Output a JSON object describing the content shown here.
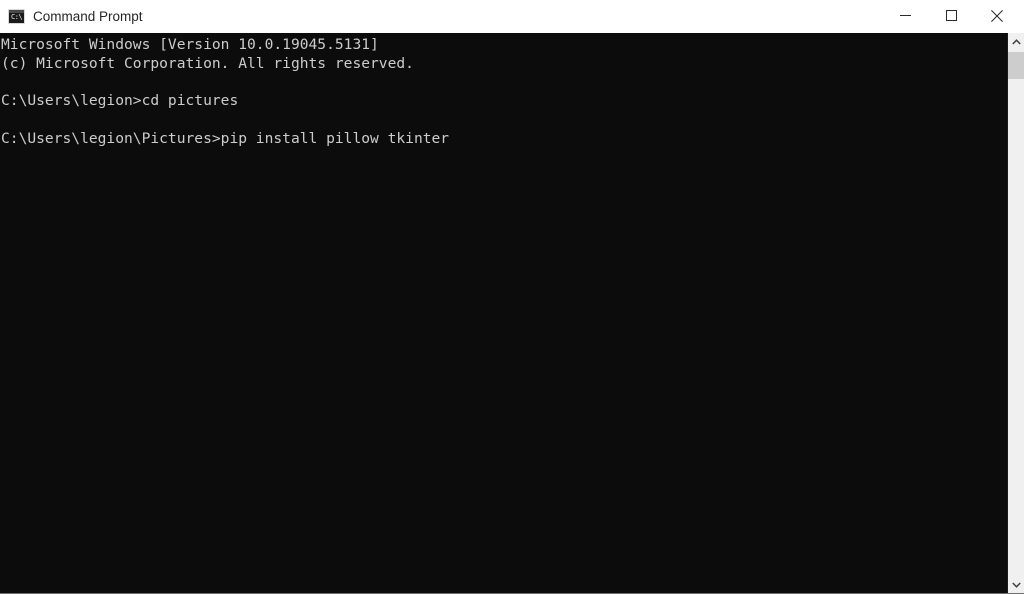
{
  "window": {
    "title": "Command Prompt",
    "icon": "console-icon",
    "icon_glyph": "C:\\",
    "background_color": "#0c0c0c",
    "titlebar_color": "#ffffff",
    "text_color": "#cccccc"
  },
  "titlebar": {
    "controls": [
      {
        "name": "minimize-button",
        "label": "Minimize",
        "glyph": "minimize-icon"
      },
      {
        "name": "maximize-button",
        "label": "Maximize",
        "glyph": "maximize-icon"
      },
      {
        "name": "close-button",
        "label": "Close",
        "glyph": "close-icon"
      }
    ]
  },
  "console": {
    "lines": [
      "Microsoft Windows [Version 10.0.19045.5131]",
      "(c) Microsoft Corporation. All rights reserved.",
      "",
      "C:\\Users\\legion>cd pictures",
      "",
      "C:\\Users\\legion\\Pictures>pip install pillow tkinter"
    ],
    "text": "Microsoft Windows [Version 10.0.19045.5131]\n(c) Microsoft Corporation. All rights reserved.\n\nC:\\Users\\legion>cd pictures\n\nC:\\Users\\legion\\Pictures>pip install pillow tkinter",
    "os_name": "Microsoft Windows",
    "os_version": "10.0.19045.5131",
    "copyright": "(c) Microsoft Corporation. All rights reserved.",
    "commands": [
      {
        "prompt": "C:\\Users\\legion>",
        "command": "cd pictures"
      },
      {
        "prompt": "C:\\Users\\legion\\Pictures>",
        "command": "pip install pillow tkinter"
      }
    ]
  },
  "scrollbar": {
    "up_arrow": "chevron-up-icon",
    "down_arrow": "chevron-down-icon",
    "thumb_label": "scrollbar-thumb",
    "track_color": "#f0f0f0",
    "thumb_color": "#cdcdcd"
  }
}
